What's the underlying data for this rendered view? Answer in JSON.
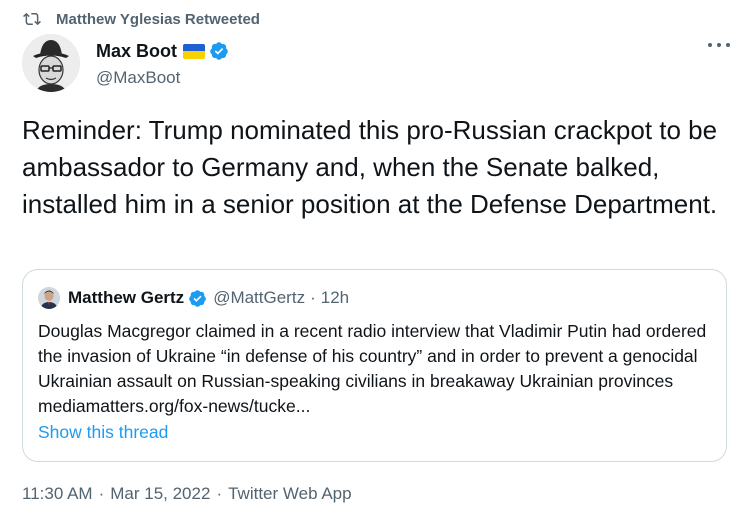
{
  "retweet": {
    "text": "Matthew Yglesias Retweeted",
    "icon": "retweet-icon"
  },
  "author": {
    "display_name": "Max Boot",
    "handle": "@MaxBoot",
    "flag_colors": [
      "#1e5fd1",
      "#f8d100"
    ],
    "verified_color": "#1d9bf0"
  },
  "tweet": {
    "text": "Reminder: Trump nominated this pro-Russian crackpot to be ambassador to Germany and, when the Senate balked, installed him in a senior position at the Defense Department."
  },
  "quote": {
    "display_name": "Matthew Gertz",
    "handle": "@MattGertz",
    "separator": "·",
    "time": "12h",
    "text": "Douglas Macgregor claimed in a recent radio interview that Vladimir Putin had ordered the invasion of Ukraine “in defense of his country” and in order to prevent a genocidal Ukrainian assault on Russian-speaking civilians in breakaway Ukrainian provinces mediamatters.org/fox-news/tucke...",
    "show_thread": "Show this thread"
  },
  "meta": {
    "time": "11:30 AM",
    "sep1": "·",
    "date": "Mar 15, 2022",
    "sep2": "·",
    "source": "Twitter Web App"
  },
  "colors": {
    "text": "#0f1419",
    "muted": "#536471",
    "link": "#1d9bf0",
    "border": "#cfd9de"
  }
}
